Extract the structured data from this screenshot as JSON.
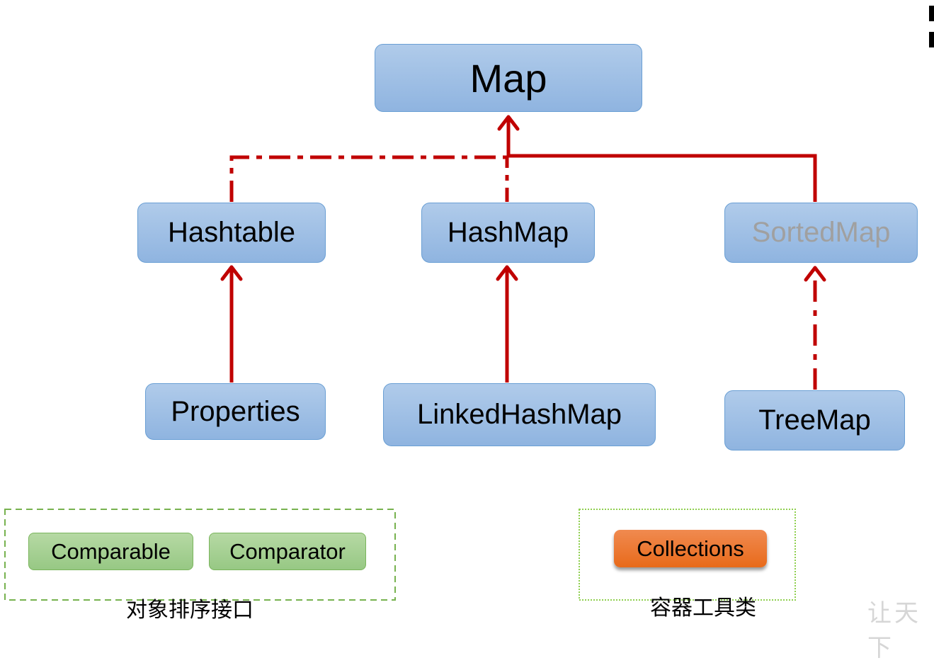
{
  "diagram": {
    "nodes": {
      "map": "Map",
      "hashtable": "Hashtable",
      "hashmap": "HashMap",
      "sortedmap": "SortedMap",
      "properties": "Properties",
      "linkedhashmap": "LinkedHashMap",
      "treemap": "TreeMap"
    },
    "edges": [
      {
        "from": "Hashtable",
        "to": "Map",
        "style": "dash-dot"
      },
      {
        "from": "HashMap",
        "to": "Map",
        "style": "dash-dot"
      },
      {
        "from": "SortedMap",
        "to": "Map",
        "style": "solid"
      },
      {
        "from": "Properties",
        "to": "Hashtable",
        "style": "solid"
      },
      {
        "from": "LinkedHashMap",
        "to": "HashMap",
        "style": "solid"
      },
      {
        "from": "TreeMap",
        "to": "SortedMap",
        "style": "dash-dot"
      }
    ],
    "sorting_group": {
      "items": [
        "Comparable",
        "Comparator"
      ],
      "caption": "对象排序接口"
    },
    "utility_group": {
      "items": [
        "Collections"
      ],
      "caption": "容器工具类"
    },
    "watermark": "让天下"
  },
  "colors": {
    "edge": "#c00000",
    "node_fill": "#9dbde5",
    "node_border": "#6a9fd4",
    "interface_text_dim": "#a0a0a0",
    "green_fill": "#a6d192",
    "orange_fill": "#ec7a33",
    "group_border": "#77b24f"
  }
}
